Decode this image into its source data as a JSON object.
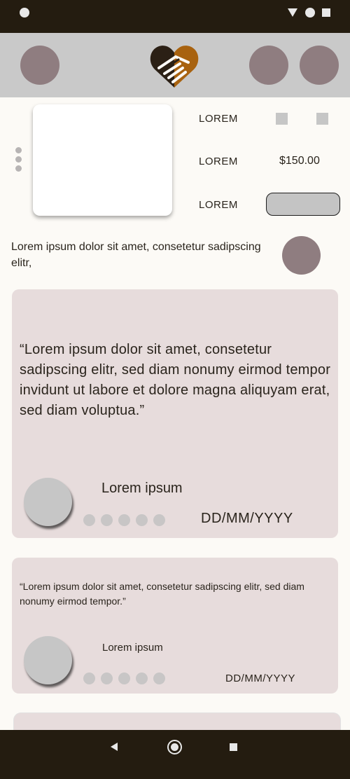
{
  "product": {
    "rows": [
      {
        "label": "LOREM"
      },
      {
        "label": "LOREM",
        "value": "$150.00"
      },
      {
        "label": "LOREM"
      }
    ],
    "description": "Lorem ipsum dolor sit amet, consetetur sadipscing elitr,"
  },
  "reviews": [
    {
      "quote": "“Lorem ipsum dolor sit amet, consetetur sadipscing elitr, sed diam nonumy eirmod tempor invidunt ut labore et dolore magna aliquyam erat, sed diam voluptua.”",
      "name": "Lorem ipsum",
      "date": "DD/MM/YYYY",
      "rating": 0
    },
    {
      "quote": "“Lorem ipsum dolor sit amet, consetetur sadipscing elitr, sed diam nonumy eirmod tempor.”",
      "name": "Lorem ipsum",
      "date": "DD/MM/YYYY",
      "rating": 0
    }
  ],
  "colors": {
    "status_bar": "#241c10",
    "header": "#c9c9c9",
    "accent_circle": "#8f7d80",
    "card": "#e7dcdc",
    "logo_dark": "#2b2015",
    "logo_orange": "#a8620f"
  },
  "icons": {
    "logo": "handshake-heart-icon",
    "menu": "kebab-menu-icon",
    "nav_back": "back-triangle-icon",
    "nav_home": "home-circle-icon",
    "nav_recent": "recent-apps-square-icon"
  }
}
